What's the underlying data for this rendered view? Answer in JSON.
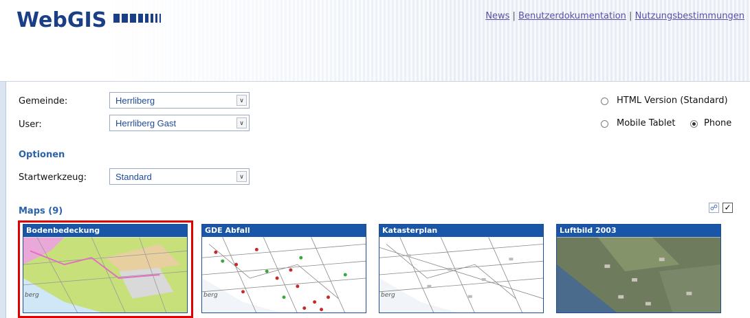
{
  "header": {
    "logo_text": "WebGIS",
    "links": [
      "News",
      "Benutzerdokumentation",
      "Nutzungsbestimmungen"
    ],
    "separator": "|"
  },
  "form": {
    "gemeinde_label": "Gemeinde:",
    "gemeinde_value": "Herrliberg",
    "user_label": "User:",
    "user_value": "Herrliberg Gast",
    "options_heading": "Optionen",
    "startwerkzeug_label": "Startwerkzeug:",
    "startwerkzeug_value": "Standard"
  },
  "version": {
    "html_label": "HTML Version (Standard)",
    "html_selected": false,
    "tablet_label": "Mobile Tablet",
    "tablet_selected": false,
    "phone_label": "Phone",
    "phone_selected": true
  },
  "maps": {
    "heading": "Maps (9)",
    "link_icon": "link-icon",
    "checkbox_checked": true,
    "cards": [
      {
        "title": "Bodenbedeckung",
        "place": "berg",
        "selected": true
      },
      {
        "title": "GDE Abfall",
        "place": "berg",
        "selected": false
      },
      {
        "title": "Katasterplan",
        "place": "berg",
        "selected": false
      },
      {
        "title": "Luftbild 2003",
        "place": "",
        "selected": false
      }
    ]
  },
  "colors": {
    "accent": "#1a56a8",
    "heading": "#2b63a8",
    "selection": "#e00000"
  }
}
